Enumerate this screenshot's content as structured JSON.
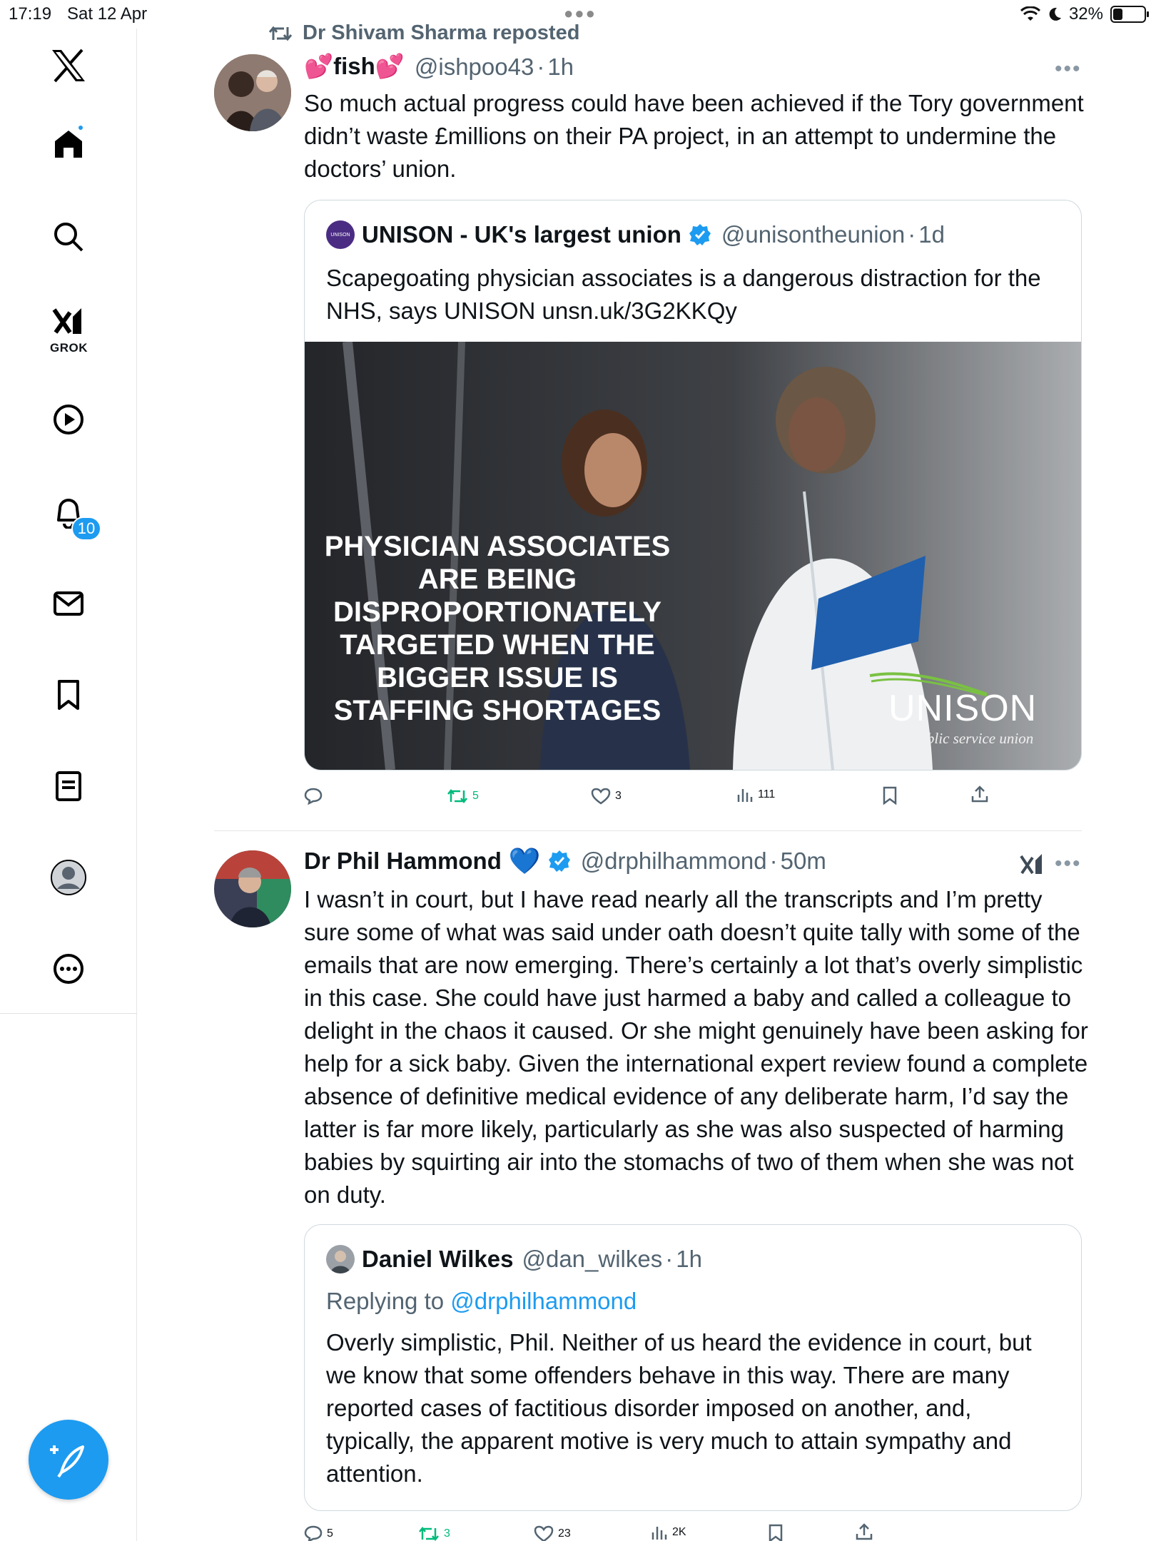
{
  "status_bar": {
    "time": "17:19",
    "date": "Sat 12 Apr",
    "battery": "32%",
    "battery_level": 0.32
  },
  "sidebar": {
    "grok_label": "GROK",
    "notifications_badge": "10",
    "items": [
      {
        "icon": "x-logo-icon"
      },
      {
        "icon": "home-icon"
      },
      {
        "icon": "search-icon"
      },
      {
        "icon": "grok-icon"
      },
      {
        "icon": "video-icon"
      },
      {
        "icon": "notifications-icon"
      },
      {
        "icon": "messages-icon"
      },
      {
        "icon": "bookmarks-icon"
      },
      {
        "icon": "lists-icon"
      },
      {
        "icon": "profile-icon"
      },
      {
        "icon": "more-icon"
      }
    ],
    "compose_icon": "compose-icon"
  },
  "feed": {
    "tweet1": {
      "repost_label": "Dr Shivam Sharma reposted",
      "name": "💕fish💕",
      "handle": "@ishpoo43",
      "time": "1h",
      "text": "So much actual progress could have been achieved if the Tory government didn’t waste £millions on their PA project, in an attempt to undermine the doctors’ union.",
      "quote": {
        "name": "UNISON - UK's largest union",
        "handle": "@unisontheunion",
        "time": "1d",
        "text": "Scapegoating physician associates is a dangerous distraction for the NHS, says UNISON unsn.uk/3G2KKQy",
        "qavatar_text": "UNISON",
        "image_headline": "PHYSICIAN ASSOCIATES ARE BEING DISPROPORTIONATELY TARGETED WHEN THE BIGGER ISSUE IS STAFFING SHORTAGES",
        "image_logo": "UNISON",
        "image_tagline": "the public service union"
      },
      "actions": {
        "reposts": "5",
        "likes": "3",
        "views": "111"
      }
    },
    "tweet2": {
      "name": "Dr Phil Hammond",
      "emoji": "💙",
      "handle": "@drphilhammond",
      "time": "50m",
      "text": "I wasn’t in court, but I have read nearly all the transcripts and I’m pretty sure some of what was said under oath doesn’t quite tally with some of the emails that are now emerging. There’s certainly a lot that’s overly simplistic in this case. She could have just harmed a baby and called a colleague to delight in the chaos it caused. Or she might genuinely have been asking for help for a sick baby. Given the international expert review found a complete absence of definitive medical evidence of any deliberate harm, I’d say the latter is far more likely, particularly as she was also suspected of harming babies by squirting air into the stomachs of two of them when she was not on duty.",
      "quote": {
        "name": "Daniel Wilkes",
        "handle": "@dan_wilkes",
        "time": "1h",
        "replying_prefix": "Replying to",
        "replying_to": "@drphilhammond",
        "text": "Overly simplistic, Phil. Neither of us heard the evidence in court, but we know that some offenders behave in this way. There are many reported cases of factitious disorder imposed on another, and, typically, the apparent motive is very much to attain sympathy and attention."
      },
      "actions": {
        "replies": "5",
        "reposts": "3",
        "likes": "23",
        "views": "2K"
      }
    }
  },
  "colors": {
    "accent": "#1d9bf0",
    "repost_green": "#00ba7c",
    "secondary_text": "#536471",
    "unison_purple": "#4b2c83",
    "unison_green": "#7ac143"
  }
}
